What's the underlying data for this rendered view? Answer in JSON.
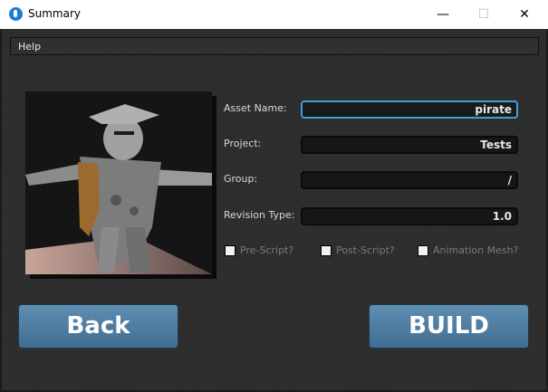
{
  "window": {
    "title": "Summary",
    "minimize": "—",
    "maximize": "☐",
    "close": "✕"
  },
  "menu": {
    "help": "Help"
  },
  "form": {
    "asset_name_label": "Asset Name:",
    "asset_name_value": "pirate",
    "project_label": "Project:",
    "project_value": "Tests",
    "group_label": "Group:",
    "group_value": "/",
    "revision_type_label": "Revision Type:",
    "revision_type_value": "1.0"
  },
  "options": {
    "pre_script": "Pre-Script?",
    "post_script": "Post-Script?",
    "animation_mesh": "Animation Mesh?"
  },
  "buttons": {
    "back": "Back",
    "build": "BUILD"
  },
  "icons": [
    "app-icon",
    "minimize-icon",
    "maximize-icon",
    "close-icon"
  ],
  "colors": {
    "focus_accent": "#3f9fd8",
    "button": "#4f7ea3"
  }
}
